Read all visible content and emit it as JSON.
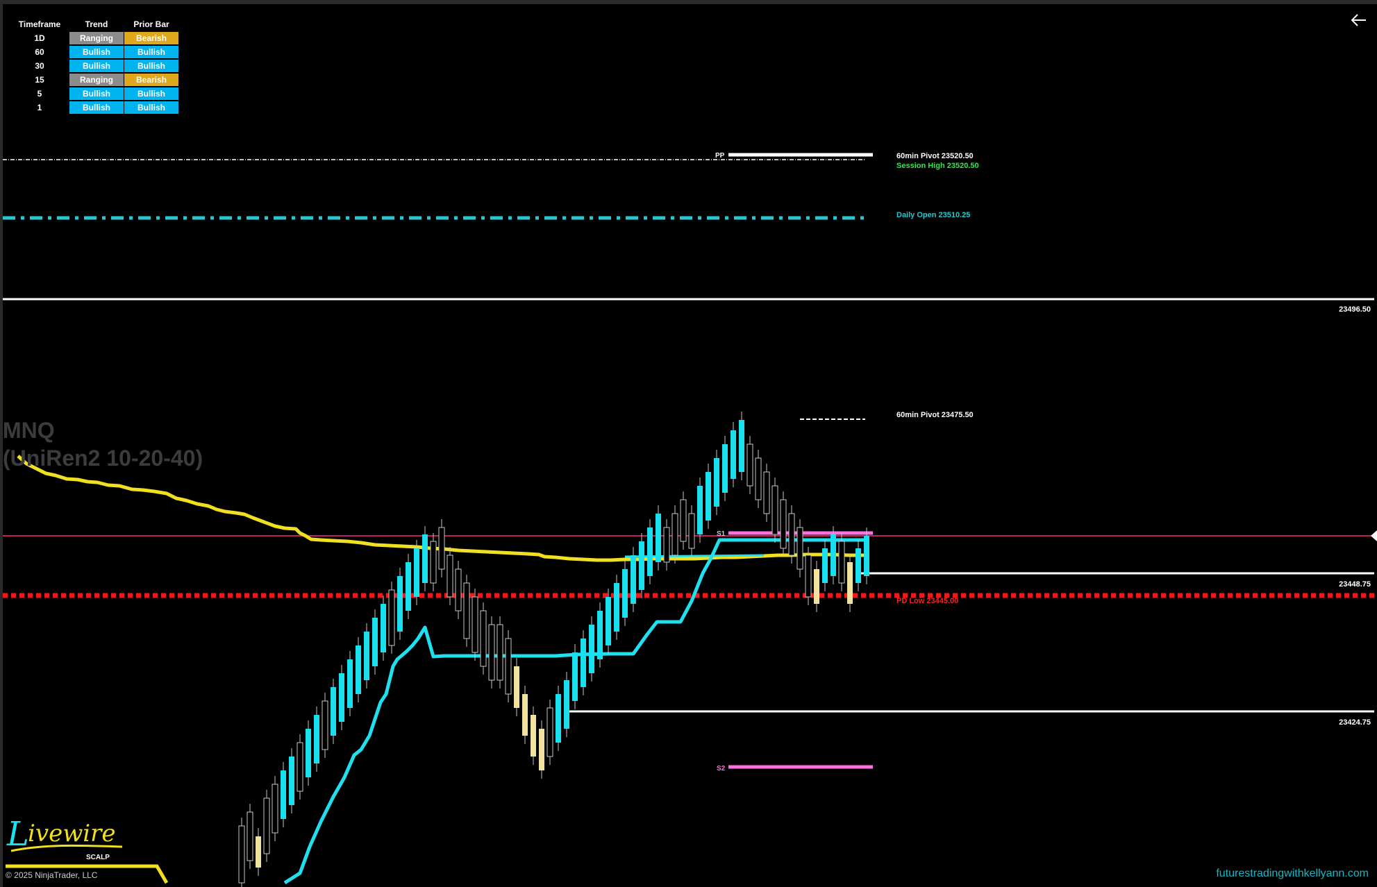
{
  "table": {
    "headers": [
      "Timeframe",
      "Trend",
      "Prior Bar"
    ],
    "rows": [
      {
        "tf": "1D",
        "trend": "Ranging",
        "prior": "Bearish"
      },
      {
        "tf": "60",
        "trend": "Bullish",
        "prior": "Bullish"
      },
      {
        "tf": "30",
        "trend": "Bullish",
        "prior": "Bullish"
      },
      {
        "tf": "15",
        "trend": "Ranging",
        "prior": "Bearish"
      },
      {
        "tf": "5",
        "trend": "Bullish",
        "prior": "Bullish"
      },
      {
        "tf": "1",
        "trend": "Bullish",
        "prior": "Bullish"
      }
    ]
  },
  "instrument": {
    "symbol": "MNQ",
    "series": "(UniRen2 10-20-40)"
  },
  "labels": {
    "pp": "PP",
    "s1": "S1",
    "s2": "S2",
    "pivot_60_upper": "60min Pivot 23520.50",
    "session_high": "Session High 23520.50",
    "daily_open": "Daily Open 23510.25",
    "pivot_60_lower": "60min Pivot 23475.50",
    "pd_low": "PD Low 23445.00"
  },
  "price_axis": {
    "level_1": "23496.50",
    "level_2": "23448.75",
    "level_3": "23424.75"
  },
  "footer": {
    "copyright": "© 2025 NinjaTrader, LLC",
    "website": "futurestradingwithkellyann.com",
    "logo_text": "Livewire",
    "logo_sub": "SCALP"
  },
  "colors": {
    "up_candle": "#18e0ee",
    "down_candle": "#000000",
    "down_outline": "#c8c8c8",
    "bear_candle": "#f2e2a0",
    "cyan_line": "#20e0f0",
    "yellow_line": "#f0e020",
    "red_dots": "#f01818",
    "magenta": "#ff70e0",
    "pink_line": "#ff2a7a",
    "session_green": "#30e850",
    "daily_open_cyan": "#28c8d0",
    "pd_low_red": "#ff2020"
  },
  "icons": {
    "back": "arrow-left-icon"
  }
}
